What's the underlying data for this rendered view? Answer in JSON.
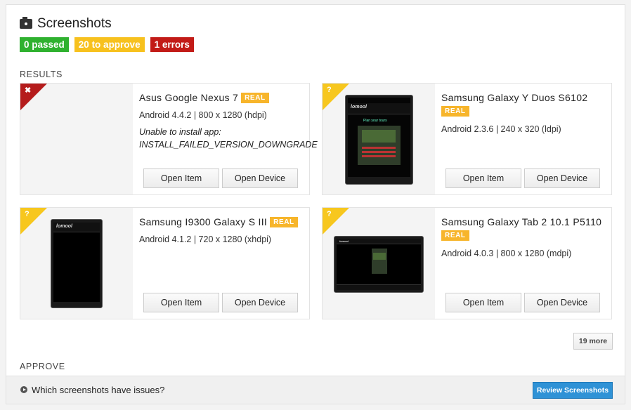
{
  "header": {
    "title": "Screenshots",
    "icon": "camera-icon"
  },
  "badges": {
    "passed": "0 passed",
    "to_approve": "20 to approve",
    "errors": "1 errors"
  },
  "colors": {
    "passed": "#2fb12f",
    "approve": "#f7c11e",
    "error": "#c21b17",
    "real": "#f7b52b",
    "primary": "#2f92d6"
  },
  "sections": {
    "results": "RESULTS",
    "approve": "APPROVE"
  },
  "results": [
    {
      "name": "Asus Google Nexus 7",
      "real_badge": "REAL",
      "spec": "Android 4.4.2 | 800 x 1280 (hdpi)",
      "status": "error",
      "status_icon": "error-x-icon",
      "corner_mark": "✖",
      "error_line1": "Unable to install app:",
      "error_line2": "INSTALL_FAILED_VERSION_DOWNGRADE",
      "open_item": "Open Item",
      "open_device": "Open Device"
    },
    {
      "name": "Samsung Galaxy Y Duos S6102",
      "real_badge": "REAL",
      "spec": "Android 2.3.6 | 240 x 320 (ldpi)",
      "status": "pending",
      "status_icon": "question-icon",
      "corner_mark": "?",
      "open_item": "Open Item",
      "open_device": "Open Device"
    },
    {
      "name": "Samsung I9300 Galaxy S III",
      "real_badge": "REAL",
      "spec": "Android 4.1.2 | 720 x 1280 (xhdpi)",
      "status": "pending",
      "status_icon": "question-icon",
      "corner_mark": "?",
      "open_item": "Open Item",
      "open_device": "Open Device"
    },
    {
      "name": "Samsung Galaxy Tab 2 10.1 P5110",
      "real_badge": "REAL",
      "spec": "Android 4.0.3 | 800 x 1280 (mdpi)",
      "status": "pending",
      "status_icon": "question-icon",
      "corner_mark": "?",
      "open_item": "Open Item",
      "open_device": "Open Device"
    }
  ],
  "more_button": "19 more",
  "footer": {
    "question": "Which screenshots have issues?",
    "review_button": "Review Screenshots"
  }
}
